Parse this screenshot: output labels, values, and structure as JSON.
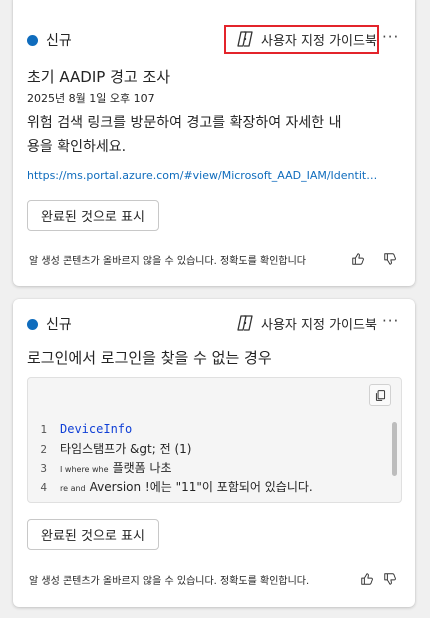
{
  "cards": [
    {
      "status": "신규",
      "guide_label": "사용자 지정 가이드북",
      "more_label": "···",
      "title": "초기 AADIP 경고 조사",
      "timestamp": "2025년 8월 1일 오후 107",
      "body_line1": "위험 검색 링크를 방문하여 경고를 확장하여 자세한 내",
      "body_line2": "용을 확인하세요.",
      "link": "https://ms.portal.azure.com/#view/Microsoft_AAD_IAM/IdentityProtectionMenuBlade",
      "mark_button": "완료된 것으로 표시",
      "disclaimer": "알 생성 콘텐츠가 올바르지 않을 수 있습니다. 정확도를 확인합니다"
    },
    {
      "status": "신규",
      "guide_label": "사용자 지정 가이드북",
      "more_label": "···",
      "title": "로그인에서 로그인을 찾을 수 없는 경우",
      "code": {
        "lines": [
          {
            "no": "1",
            "prefix": "",
            "text": "DeviceInfo"
          },
          {
            "no": "2",
            "prefix": "",
            "text": "타임스탬프가 &gt; 전 (1)"
          },
          {
            "no": "3",
            "prefix": "I where whe",
            "text": "플랫폼 나초"
          },
          {
            "no": "4",
            "prefix": "re and",
            "text": "Aversion !에는 \"11\"이 포함되어 있습니다."
          }
        ]
      },
      "mark_button": "완료된 것으로 표시",
      "disclaimer": "알 생성 콘텐츠가 올바르지 않을 수 있습니다. 정확도를 확인합니다."
    }
  ],
  "icons": {
    "status_dot": "status-dot-icon",
    "guide": "copilot-icon",
    "copy": "copy-icon",
    "thumb_up": "thumbs-up-icon",
    "thumb_down": "thumbs-down-icon"
  },
  "colors": {
    "accent": "#0f6cbd",
    "highlight": "#e3242b",
    "code_keyword": "#0f3fd6"
  }
}
